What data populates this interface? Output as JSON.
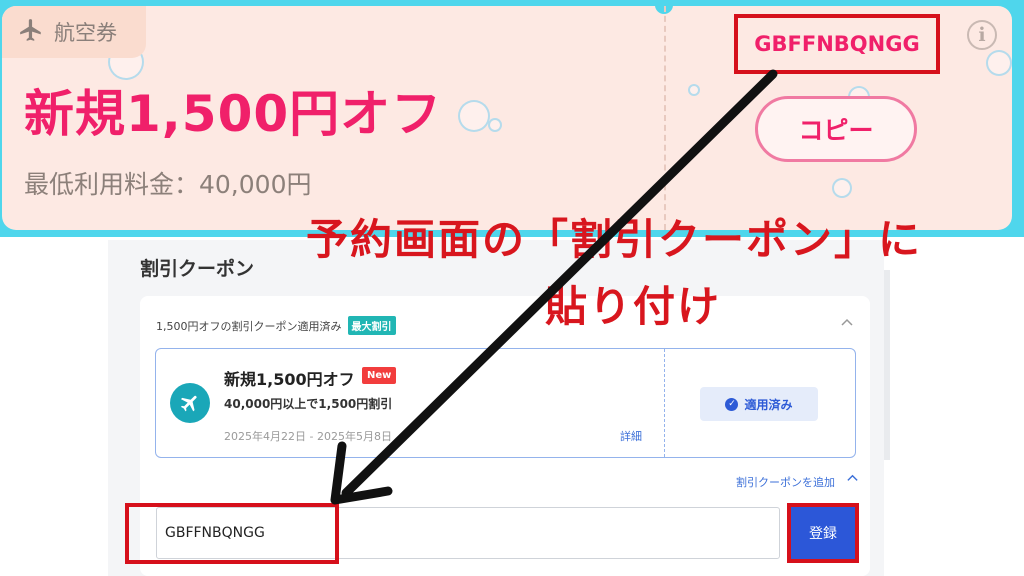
{
  "top_card": {
    "category_label": "航空券",
    "title": "新規1,500円オフ",
    "min_price": "最低利用料金：40,000円",
    "coupon_code": "GBFFNBQNGG",
    "copy_button_label": "コピー",
    "info_icon": "i",
    "colors": {
      "accent": "#f0206a",
      "card_bg": "#fde9e3",
      "frame": "#4fd6ec"
    }
  },
  "annotation": {
    "line1": "予約画面の「割引クーポン」に",
    "line2": "貼り付け",
    "color": "#d8161e"
  },
  "form": {
    "section_title": "割引クーポン",
    "applied_summary": "1,500円オフの割引クーポン適用済み",
    "max_badge": "最大割引",
    "coupon_item": {
      "title": "新規1,500円オフ",
      "new_badge": "New",
      "description": "40,000円以上で1,500円割引",
      "period": "2025年4月22日 - 2025年5月8日",
      "detail_link": "詳細",
      "applied_button": "適用済み"
    },
    "add_coupon_link": "割引クーポンを追加",
    "code_input_value": "GBFFNBQNGG",
    "register_button": "登録",
    "colors": {
      "primary": "#2c57d8",
      "teal": "#21b6b4",
      "new_red": "#f23d3d"
    }
  },
  "icons": [
    "airplane-icon",
    "info-icon",
    "chevron-up-icon",
    "check-circle-icon",
    "arrow-annotation"
  ]
}
